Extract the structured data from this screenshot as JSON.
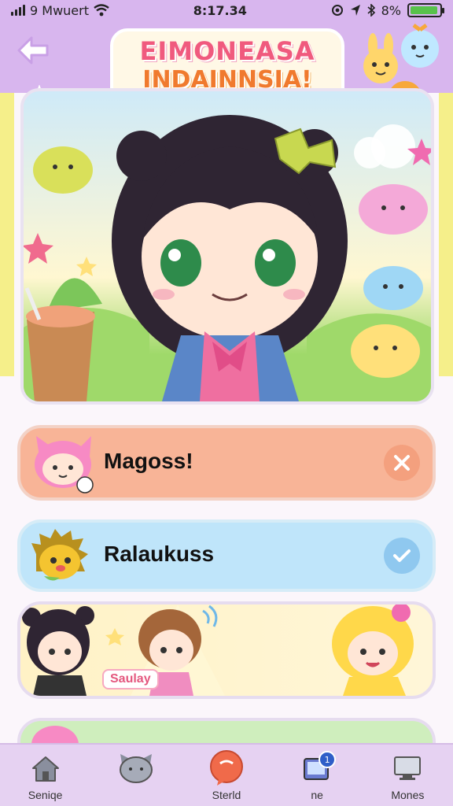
{
  "status_bar": {
    "carrier": "9 Mwuert",
    "time": "8:17.34",
    "battery_text": "8%",
    "battery_level": 0.95,
    "battery_color": "#58c24b"
  },
  "header": {
    "back_icon": "arrow-left-icon",
    "logo_line1": "EIMONEASA",
    "logo_line2": "INDAINNSIA!"
  },
  "cards": [
    {
      "label": "Magoss!",
      "color": "#f8b497",
      "action_icon": "close-icon",
      "action_color": "#f4a07e"
    },
    {
      "label": "Ralaukuss",
      "color": "#bfe5fa",
      "action_icon": "check-icon",
      "action_color": "#8fc8ef"
    }
  ],
  "friends_banner": {
    "label": "Saulay"
  },
  "nav": [
    {
      "label": "Seniqe",
      "icon": "home-icon"
    },
    {
      "label": "",
      "icon": "cat-icon"
    },
    {
      "label": "Sterld",
      "icon": "chat-icon",
      "active_color": "#f06a4a"
    },
    {
      "label": "ne",
      "icon": "device-icon",
      "badge": "1"
    },
    {
      "label": "Mones",
      "icon": "monitor-icon"
    }
  ],
  "colors": {
    "header_bg": "#d8b6ee",
    "nav_bg": "#e6d2f2",
    "accent_pink": "#f05a7e"
  }
}
